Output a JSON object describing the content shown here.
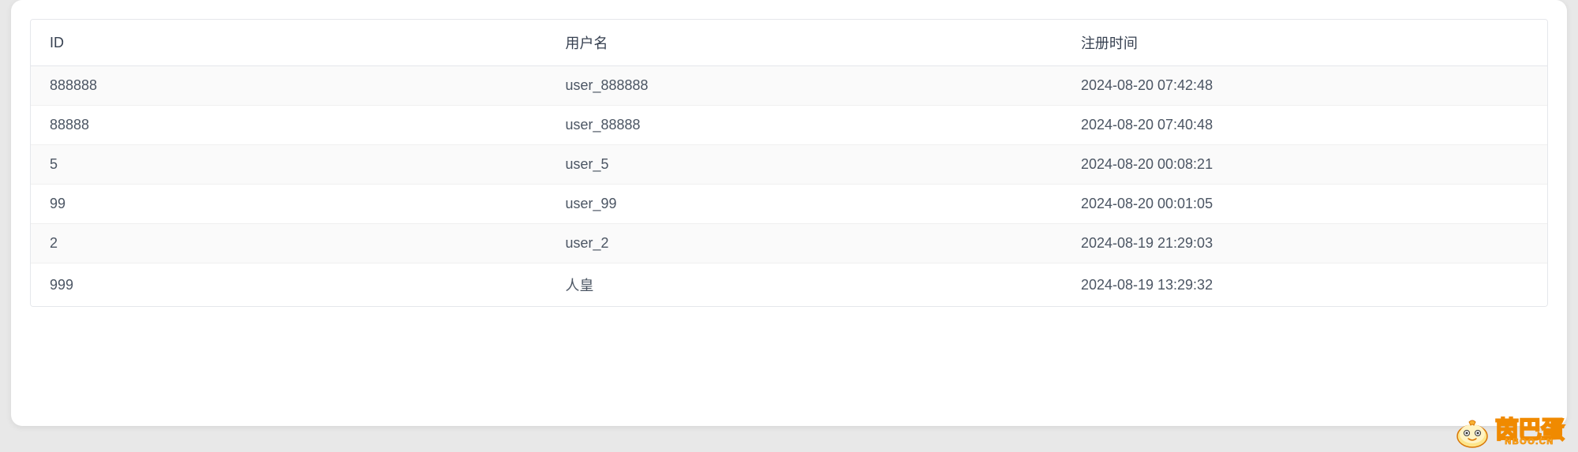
{
  "table": {
    "headers": {
      "id": "ID",
      "username": "用户名",
      "registered_at": "注册时间"
    },
    "rows": [
      {
        "id": "888888",
        "username": "user_888888",
        "registered_at": "2024-08-20 07:42:48"
      },
      {
        "id": "88888",
        "username": "user_88888",
        "registered_at": "2024-08-20 07:40:48"
      },
      {
        "id": "5",
        "username": "user_5",
        "registered_at": "2024-08-20 00:08:21"
      },
      {
        "id": "99",
        "username": "user_99",
        "registered_at": "2024-08-20 00:01:05"
      },
      {
        "id": "2",
        "username": "user_2",
        "registered_at": "2024-08-19 21:29:03"
      },
      {
        "id": "999",
        "username": "人皇",
        "registered_at": "2024-08-19 13:29:32"
      }
    ]
  },
  "watermark": {
    "text": "茵巴蛋",
    "subtext": "NBOO.CN"
  }
}
